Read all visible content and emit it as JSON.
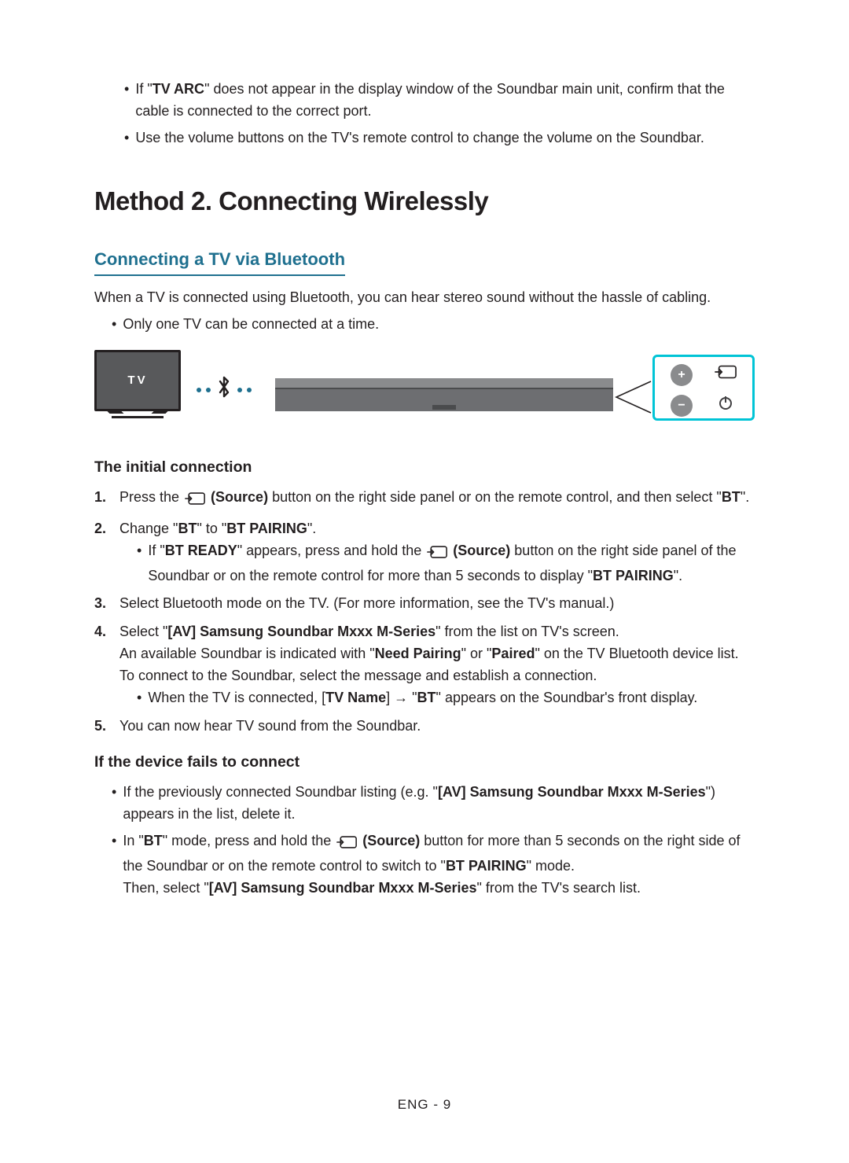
{
  "top_bullets": [
    {
      "prefix": "If \"",
      "bold": "TV ARC",
      "suffix": "\" does not appear in the display window of the Soundbar main unit, confirm that the cable is connected to the correct port."
    },
    {
      "text": "Use the volume buttons on the TV's remote control to change the volume on the Soundbar."
    }
  ],
  "method_title": "Method 2. Connecting Wirelessly",
  "subhead": "Connecting a TV via Bluetooth",
  "intro": "When a TV is connected using Bluetooth, you can hear stereo sound without the hassle of cabling.",
  "intro_bullet": "Only one TV can be connected at a time.",
  "diagram": {
    "tv_label": "TV",
    "controls": {
      "plus": "+",
      "minus": "−",
      "source": "source",
      "power": "power"
    }
  },
  "initial_heading": "The initial connection",
  "steps": {
    "s1": {
      "a": "Press the ",
      "b": " (Source)",
      "c": " button on the right side panel or on the remote control, and then select \"",
      "d": "BT",
      "e": "\"."
    },
    "s2": {
      "a": "Change \"",
      "b": "BT",
      "c": "\" to \"",
      "d": "BT PAIRING",
      "e": "\".",
      "sub_a": "If \"",
      "sub_b": "BT READY",
      "sub_c": "\" appears, press and hold the ",
      "sub_d": " (Source)",
      "sub_e": " button on the right side panel of the Soundbar or on the remote control for more than 5 seconds to display \"",
      "sub_f": "BT PAIRING",
      "sub_g": "\"."
    },
    "s3": "Select Bluetooth mode on the TV. (For more information, see the TV's manual.)",
    "s4": {
      "a": "Select \"",
      "b": "[AV] Samsung Soundbar Mxxx M-Series",
      "c": "\" from the list on TV's screen.",
      "line2a": "An available Soundbar is indicated with \"",
      "line2b": "Need Pairing",
      "line2c": "\" or \"",
      "line2d": "Paired",
      "line2e": "\" on the TV Bluetooth device list. To connect to the Soundbar, select the message and establish a connection.",
      "sub_a": "When the TV is connected, [",
      "sub_b": "TV Name",
      "sub_c": "] → \"",
      "sub_d": "BT",
      "sub_e": "\" appears on the Soundbar's front display."
    },
    "s5": "You can now hear TV sound from the Soundbar."
  },
  "fails_heading": "If the device fails to connect",
  "fails": {
    "b1a": "If the previously connected Soundbar listing (e.g. \"",
    "b1b": "[AV] Samsung Soundbar Mxxx M-Series",
    "b1c": "\") appears in the list, delete it.",
    "b2a": "In \"",
    "b2b": "BT",
    "b2c": "\" mode, press and hold the ",
    "b2d": " (Source)",
    "b2e": " button for more than 5 seconds on the right side of the Soundbar or on the remote control to switch to \"",
    "b2f": "BT PAIRING",
    "b2g": "\" mode.",
    "b2h": "Then, select \"",
    "b2i": "[AV] Samsung Soundbar Mxxx M-Series",
    "b2j": "\" from the TV's search list."
  },
  "footer": "ENG - 9"
}
